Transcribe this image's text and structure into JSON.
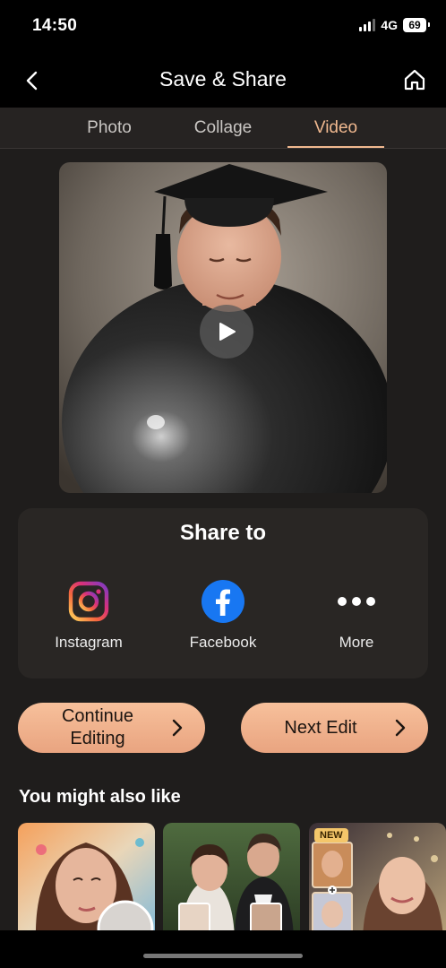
{
  "status": {
    "time": "14:50",
    "network": "4G",
    "battery": "69"
  },
  "nav": {
    "title": "Save & Share"
  },
  "tabs": [
    {
      "label": "Photo",
      "active": false
    },
    {
      "label": "Collage",
      "active": false
    },
    {
      "label": "Video",
      "active": true
    }
  ],
  "preview": {
    "icon": "play-icon"
  },
  "share": {
    "title": "Share to",
    "items": [
      {
        "label": "Instagram",
        "icon": "instagram-icon"
      },
      {
        "label": "Facebook",
        "icon": "facebook-icon"
      },
      {
        "label": "More",
        "icon": "more-icon"
      }
    ]
  },
  "actions": {
    "continue_line1": "Continue",
    "continue_line2": "Editing",
    "next_edit": "Next Edit"
  },
  "suggestions": {
    "title": "You might also like",
    "items": [
      {
        "name": "portrait-woman-colorful"
      },
      {
        "name": "couple-wedding"
      },
      {
        "name": "collage-woman",
        "badge": "NEW"
      }
    ]
  },
  "colors": {
    "accent": "#f0b88f",
    "button_gradient_top": "#f7c09b",
    "button_gradient_bottom": "#e9a480",
    "background": "#1f1d1c",
    "card": "#292624",
    "facebook": "#1877f2"
  }
}
